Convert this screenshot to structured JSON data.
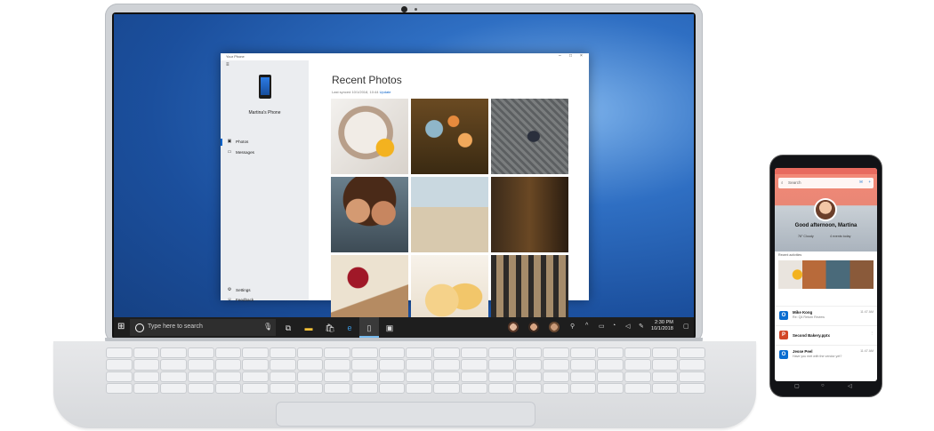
{
  "window": {
    "title": "Your Phone",
    "controls": [
      "–",
      "□",
      "×"
    ]
  },
  "sidebar": {
    "phone_name": "Martina's Phone",
    "items": [
      {
        "label": "Photos",
        "icon": "photo-icon"
      },
      {
        "label": "Messages",
        "icon": "message-icon"
      }
    ],
    "footer": [
      {
        "label": "Settings",
        "icon": "gear-icon"
      },
      {
        "label": "Feedback",
        "icon": "feedback-icon"
      }
    ]
  },
  "main": {
    "title": "Recent Photos",
    "last_synced": "Last synced 10/1/2018, 10:44",
    "update_link": "Update",
    "photos": [
      "dog-photo",
      "flowers-photo",
      "feet-photo",
      "kids-selfie-photo",
      "beach-photo",
      "bakery-sign-photo",
      "cake-photo",
      "pastry-photo",
      "storefront-photo"
    ]
  },
  "taskbar": {
    "search_placeholder": "Type here to search",
    "time": "2:30 PM",
    "date": "10/1/2018"
  },
  "phone": {
    "search_placeholder": "Search",
    "greeting": "Good afternoon, Martina",
    "meta_left": "76° Cloudy",
    "meta_right": "4 events today",
    "recent_label": "Recent activities",
    "activities": [
      {
        "name": "Mike Kong",
        "desc": "Re: Q4 Return Review",
        "time": "11:47 AM",
        "app": "O",
        "color": "#0a6ed1"
      },
      {
        "name": "Second Bakery.pptx",
        "desc": "",
        "time": "",
        "app": "P",
        "color": "#d24726"
      },
      {
        "name": "Jesse Peel",
        "desc": "Have you met with the vendor yet?",
        "time": "11:47 AM",
        "app": "O",
        "color": "#0a6ed1"
      }
    ]
  }
}
